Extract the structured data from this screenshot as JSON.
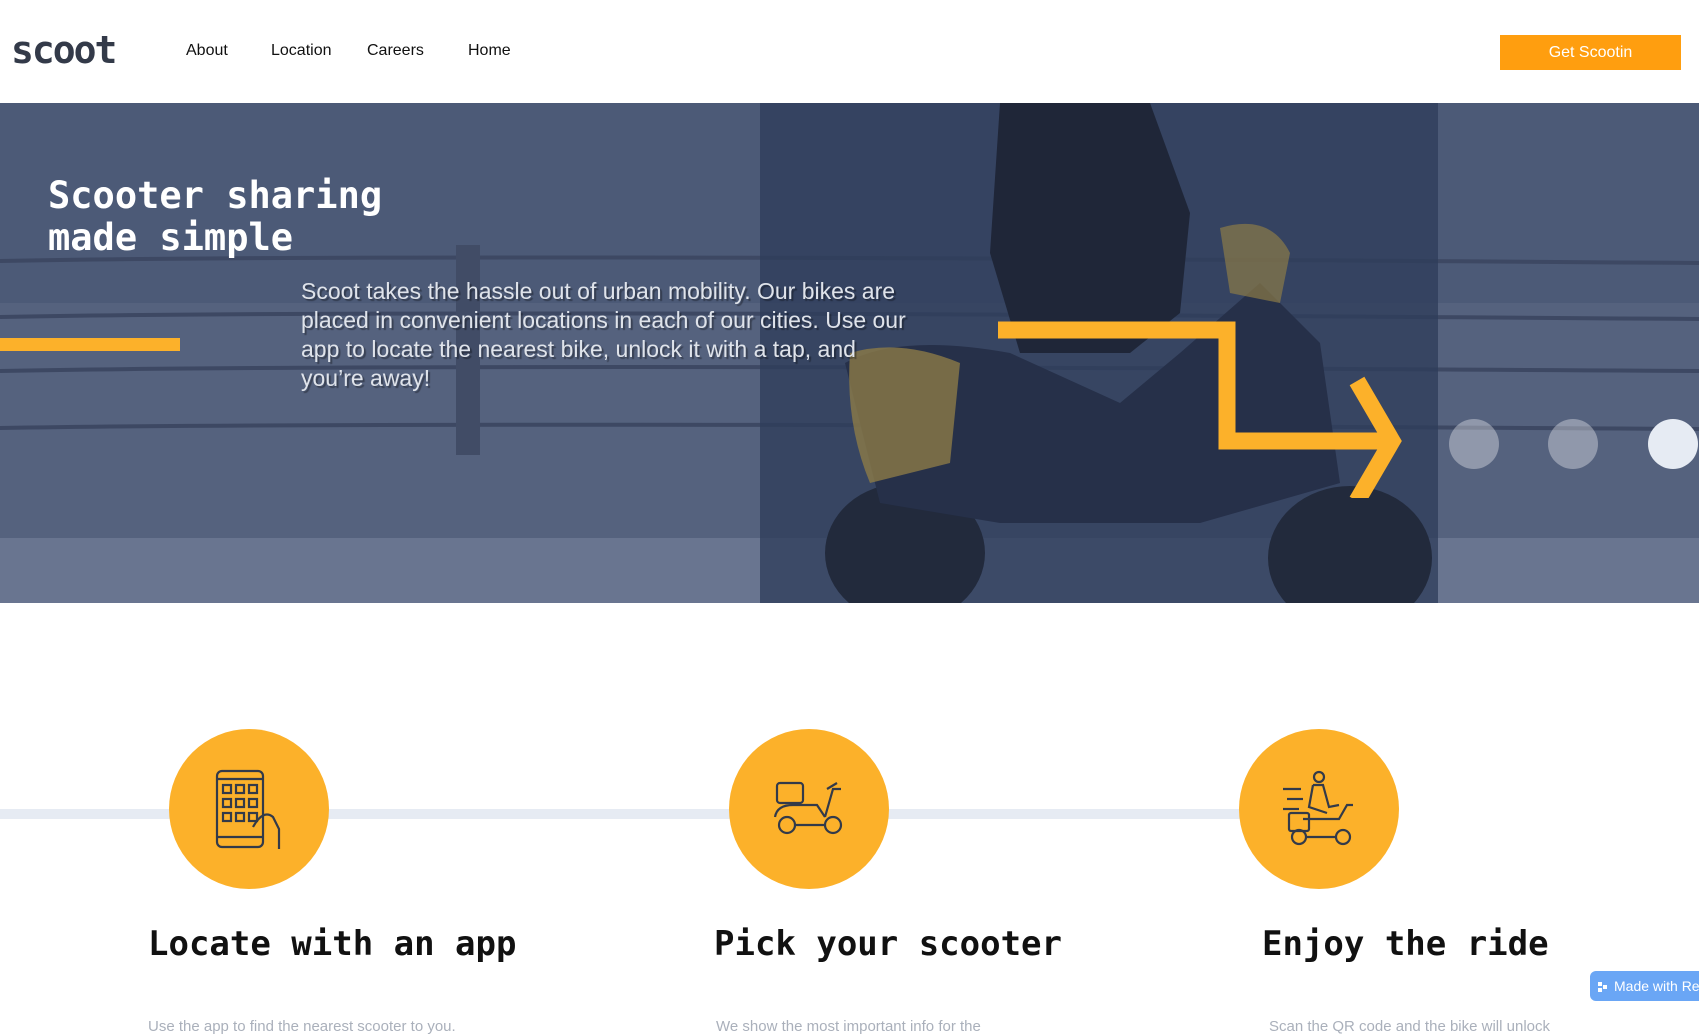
{
  "header": {
    "logo": "scoot",
    "nav": [
      "About",
      "Location",
      "Careers",
      "Home"
    ],
    "cta_label": "Get Scootin"
  },
  "hero": {
    "title_line1": "Scooter sharing",
    "title_line2": "made simple",
    "text": "Scoot takes the hassle out of urban mobility. Our bikes are placed in convenient locations in each of our cities. Use our app to locate the nearest bike, unlock it with a tap, and you’re away!",
    "slides_total": 3,
    "active_slide": 3
  },
  "steps": [
    {
      "title": "Locate with an app",
      "icon": "phone-app-icon",
      "description": "Use the app to find the nearest scooter to you."
    },
    {
      "title": "Pick your scooter",
      "icon": "scooter-icon",
      "description": "We show the most important info for the"
    },
    {
      "title": "Enjoy the ride",
      "icon": "rider-icon",
      "description": "Scan the QR code and the bike will unlock"
    }
  ],
  "badge": {
    "label": "Made with Re"
  },
  "colors": {
    "accent": "#fcb12a",
    "cta": "#ff9e0f",
    "hero_overlay": "#2e3c5a",
    "logo": "#333a49",
    "step_line": "#e6ebf3"
  }
}
